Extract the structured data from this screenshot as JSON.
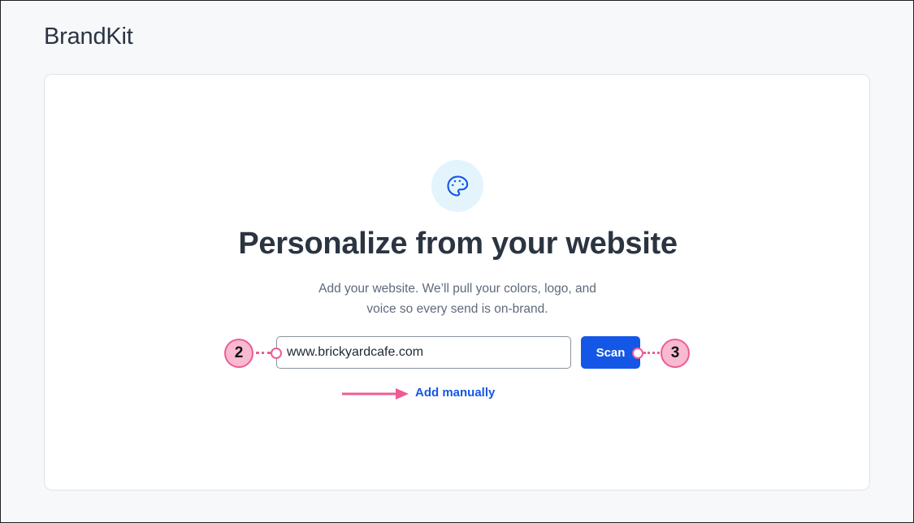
{
  "app": {
    "title": "BrandKit"
  },
  "main": {
    "heading": "Personalize from your website",
    "subtitle_line1": "Add your website. We’ll pull your colors, logo, and",
    "subtitle_line2": "voice so every send is on-brand.",
    "website_input": {
      "value": "www.brickyardcafe.com",
      "placeholder": ""
    },
    "scan_label": "Scan",
    "add_manually_label": "Add manually",
    "icon": "palette-icon"
  },
  "annotations": {
    "callout_input": "2",
    "callout_scan": "3"
  },
  "colors": {
    "accent": "#1457e6",
    "callout_fill": "#f9b9d0",
    "callout_stroke": "#ee5c95",
    "icon_bg": "#e3f4fd",
    "text": "#2b3441"
  }
}
